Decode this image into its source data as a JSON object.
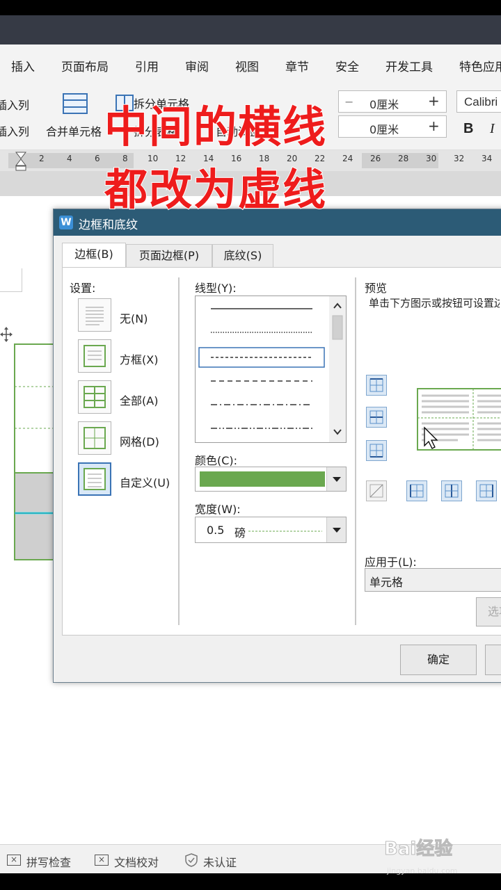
{
  "menu": {
    "items": [
      "插入",
      "页面布局",
      "引用",
      "审阅",
      "视图",
      "章节",
      "安全",
      "开发工具",
      "特色应用"
    ]
  },
  "toolbar": {
    "insert_col_left": "插入列",
    "insert_col_right": "插入列",
    "merge_cells": "合并单元格",
    "split_cells": "拆分单元格",
    "split_table": "拆分表格",
    "auto_fit": "自动调整",
    "height_value": "0厘米",
    "width_value": "0厘米",
    "font_name": "Calibri",
    "bold": "B",
    "italic": "I"
  },
  "ruler": {
    "numbers": [
      "2",
      "4",
      "6",
      "8",
      "10",
      "12",
      "14",
      "16",
      "18",
      "20",
      "22",
      "24",
      "26",
      "28",
      "30",
      "32",
      "34"
    ]
  },
  "overlay": {
    "line1": "中间的横线",
    "line2": "都改为虚线"
  },
  "dialog": {
    "title": "边框和底纹",
    "tabs": [
      "边框(B)",
      "页面边框(P)",
      "底纹(S)"
    ],
    "settings_label": "设置:",
    "settings": [
      "无(N)",
      "方框(X)",
      "全部(A)",
      "网格(D)",
      "自定义(U)"
    ],
    "line_style_label": "线型(Y):",
    "color_label": "颜色(C):",
    "color_value": "#6aa84f",
    "width_label": "宽度(W):",
    "width_value": "0.5",
    "width_unit": "磅",
    "preview_label": "预览",
    "preview_hint": "单击下方图示或按钮可设置边框",
    "apply_label": "应用于(L):",
    "apply_value": "单元格",
    "options_button": "选项",
    "ok_button": "确定"
  },
  "status": {
    "spell_check": "拼写检查",
    "doc_proof": "文档校对",
    "uncertified": "未认证"
  },
  "watermark": {
    "brand": "Bai经验",
    "url": "jingyan.baidu.com"
  },
  "colors": {
    "accent_green": "#6aa84f",
    "title_blue": "#2c5b76",
    "overlay_red": "#ee1c1c"
  }
}
